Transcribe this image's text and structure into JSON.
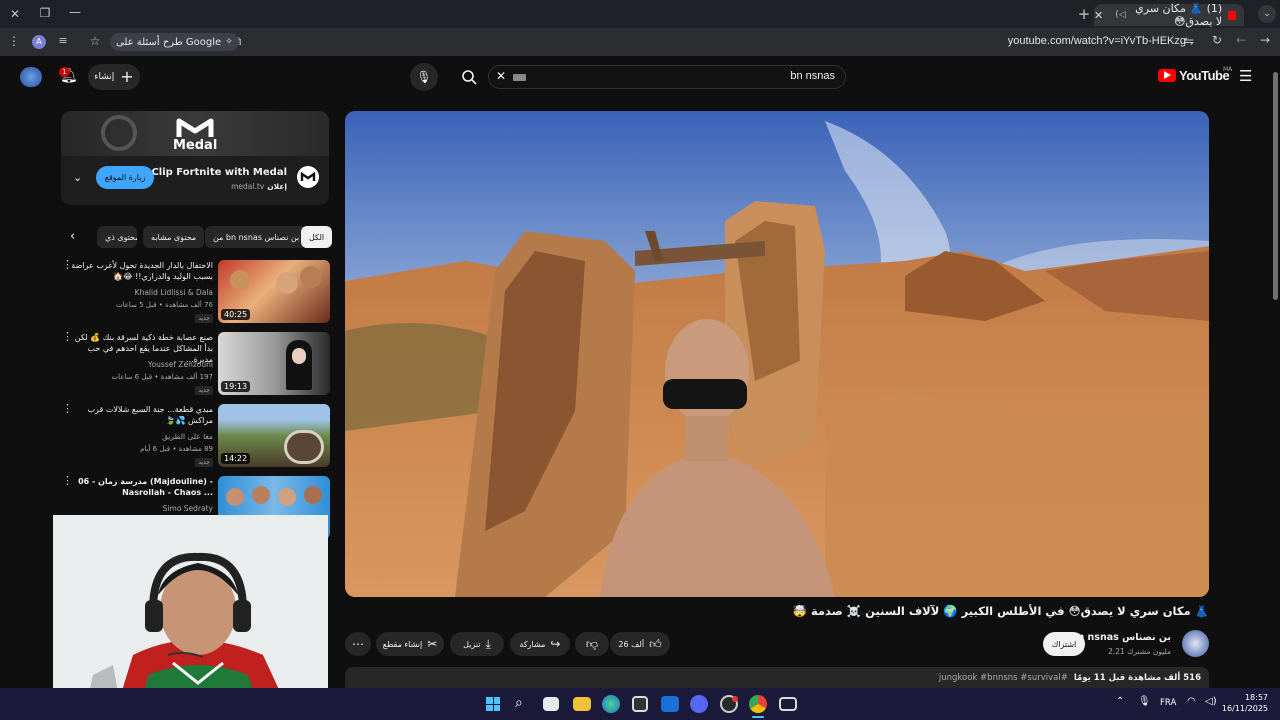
{
  "browser": {
    "tab_title": "(1) 👗 مكان سري لا يصدق😳",
    "url": "youtube.com/watch?v=iYvTb-HEKzg",
    "google_chip": "طرح أسئلة على Google",
    "profile_letter": "A"
  },
  "yt": {
    "search_query": "bn nsnas",
    "logo": "YouTube",
    "region": "MA",
    "create_label": "إنشاء",
    "notif_count": "1"
  },
  "ad": {
    "brand": "Medal",
    "title": "Clip Fortnite with Medal",
    "sponsor": "إعلان",
    "domain": "medal.tv",
    "cta": "زيارة الموقع"
  },
  "filters": [
    {
      "label": "الكل",
      "active": true
    },
    {
      "label": "من bn nsnas بن نصناس",
      "active": false
    },
    {
      "label": "محتوى مشابه",
      "active": false
    },
    {
      "label": "محتوى ذي",
      "active": false
    }
  ],
  "related": [
    {
      "title": "الاحتفال بالدار الجديدة تحول لأغرب عراضة بسبب الوليد والدراري!! 😂🏠",
      "channel": "Khalid Lidlissi & Dala",
      "meta": "76 ألف مشاهدة • قبل 5 ساعات",
      "badge": "جديد",
      "duration": "40:25"
    },
    {
      "title": "صنع عصابة خطة ذكية لسرقة بنك 💰 لكن بدأ المشاكل عندما يقع احدهم في حب مديرة...",
      "channel": "Youssef Zenzouni",
      "meta": "197 ألف مشاهدة • قبل 6 ساعات",
      "badge": "جديد",
      "duration": "19:13"
    },
    {
      "title": "مبدي قطعة... جنة السبع شلالات قرب مراكش 💦🍃",
      "channel": "مغا على الطريق",
      "meta": "89 مشاهدة • قبل 6 أيام",
      "badge": "جديد",
      "duration": "14:22"
    },
    {
      "title": "مدرسة زمان - 06 (Majdouline) - Nasrollah - Chaos ...",
      "channel": "Simo Sedraty",
      "meta": "",
      "badge": "",
      "duration": ""
    }
  ],
  "video": {
    "title": "👗 مكان سري لا يصدق😳 في الأطلس الكبير 🌍 لآلاف السنين ☠️ صدمة 🤯",
    "channel": "bn nsnas بن نصناس",
    "subs": "2.21 مليون مشترك",
    "subscribe": "اشتراك",
    "likes": "26 ألف",
    "share": "مشاركة",
    "download": "تنزيل",
    "clip": "إنشاء مقطع",
    "desc_meta": "516 ألف مشاهدة قبل 11 يومًا",
    "desc_tags": "#jungkook #bnnsns #survival"
  },
  "taskbar": {
    "lang": "FRA",
    "time": "18:57",
    "date": "16/11/2025"
  }
}
